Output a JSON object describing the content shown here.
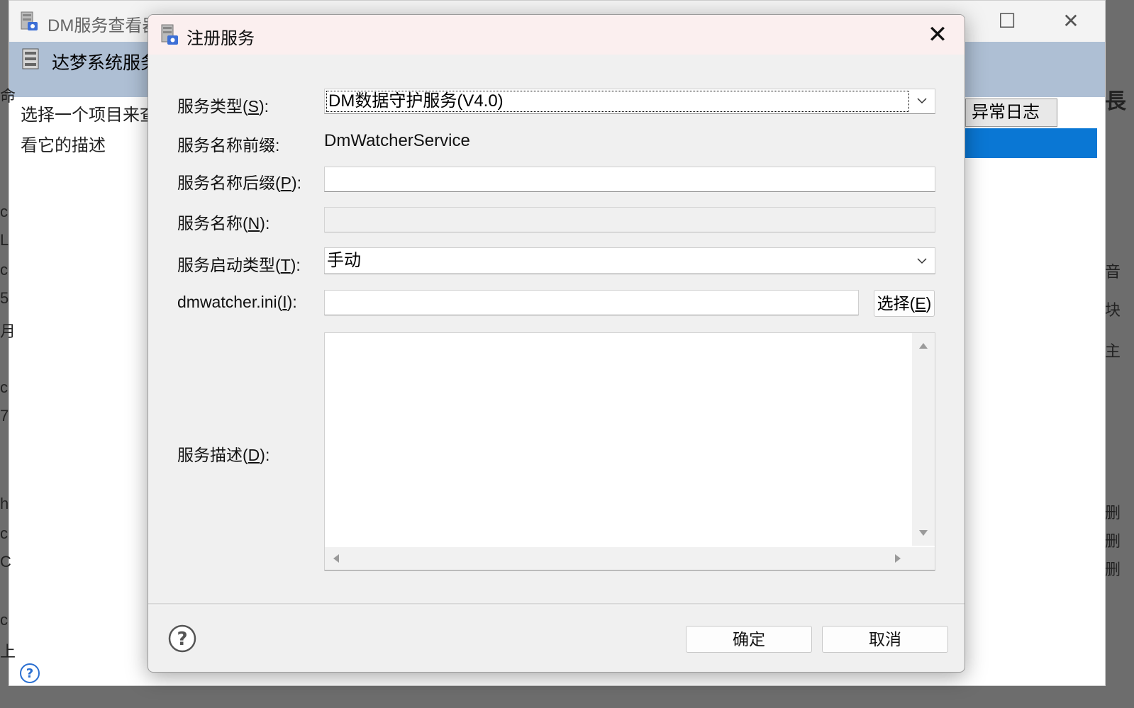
{
  "background_window": {
    "title": "DM服务查看器",
    "header": "达梦系统服务",
    "description": "选择一个项目来查看它的描述",
    "error_log_button": "异常日志",
    "left_edge_chars": [
      "命",
      "c",
      "L",
      "c",
      "5",
      "月",
      "c",
      "7",
      "h",
      "c",
      "C",
      "c",
      "上"
    ],
    "right_edge_chars": [
      "長",
      "音",
      "块",
      "主",
      "删",
      "删",
      "删"
    ]
  },
  "dialog": {
    "title": "注册服务",
    "fields": {
      "service_type": {
        "label": "服务类型(",
        "mnemonic": "S",
        "suffix": "):",
        "value": "DM数据守护服务(V4.0)"
      },
      "name_prefix": {
        "label": "服务名称前缀:",
        "value": "DmWatcherService"
      },
      "name_suffix": {
        "label": "服务名称后缀(",
        "mnemonic": "P",
        "suffix": "):",
        "value": ""
      },
      "service_name": {
        "label": "服务名称(",
        "mnemonic": "N",
        "suffix": "):",
        "value": ""
      },
      "start_type": {
        "label": "服务启动类型(",
        "mnemonic": "T",
        "suffix": "):",
        "value": "手动"
      },
      "ini_file": {
        "label": "dmwatcher.ini(",
        "mnemonic": "I",
        "suffix": "):",
        "value": ""
      },
      "description": {
        "label": "服务描述(",
        "mnemonic": "D",
        "suffix": "):",
        "value": ""
      }
    },
    "choose_button": {
      "label": "选择(",
      "mnemonic": "E",
      "suffix": ")"
    },
    "ok_button": "确定",
    "cancel_button": "取消"
  }
}
